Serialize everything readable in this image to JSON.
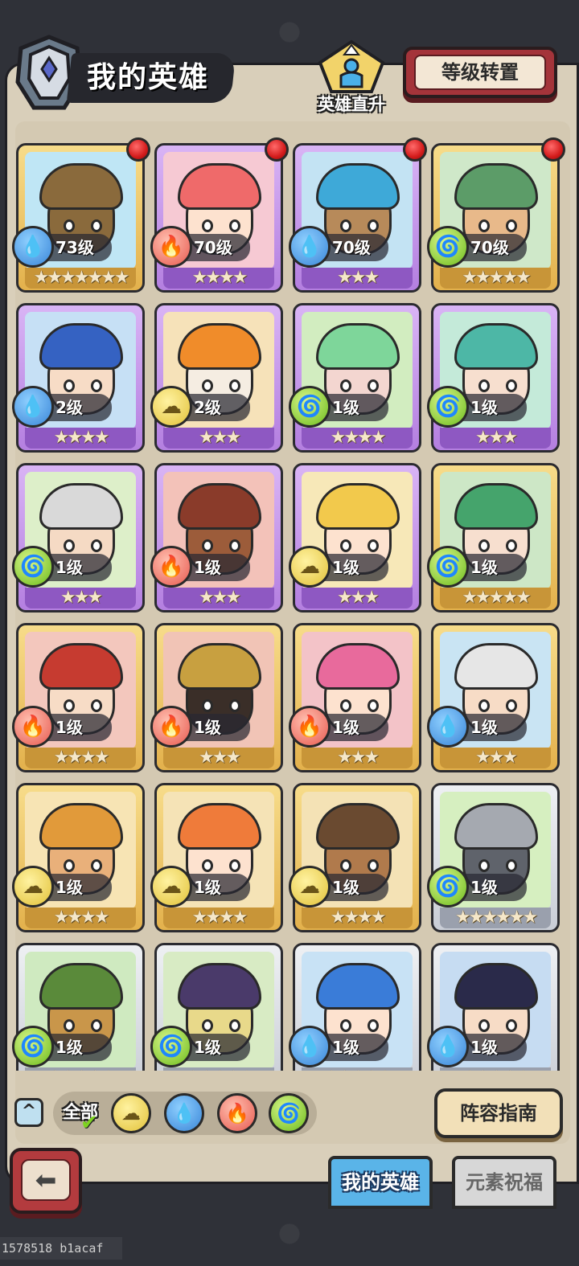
{
  "header": {
    "title": "我的英雄",
    "direct_upgrade_label": "英雄直升",
    "level_transfer_label": "等级转置",
    "emblem_icon": "hero-helmet-icon",
    "direct_upgrade_icon": "hero-arrow-up-icon"
  },
  "heroes": [
    {
      "level": "73级",
      "stars": "★★★★★★★",
      "element": "water",
      "rarity": "gold",
      "red_dot": true,
      "hair": "#8a6a3c",
      "skin": "#8a6a3c",
      "bg": "#bfe6f5"
    },
    {
      "level": "70级",
      "stars": "★★★★",
      "element": "fire",
      "rarity": "purple",
      "red_dot": true,
      "hair": "#ef6a6a",
      "skin": "#fde2cf",
      "bg": "#f6c9d3"
    },
    {
      "level": "70级",
      "stars": "★★★",
      "element": "water",
      "rarity": "purple",
      "red_dot": true,
      "hair": "#3ea9d8",
      "skin": "#b78a5a",
      "bg": "#c3e3f3"
    },
    {
      "level": "70级",
      "stars": "★★★★★",
      "element": "wind",
      "rarity": "gold",
      "red_dot": true,
      "hair": "#5c9c68",
      "skin": "#e8b98a",
      "bg": "#cfe8c9"
    },
    {
      "level": "2级",
      "stars": "★★★★",
      "element": "water",
      "rarity": "purple",
      "red_dot": false,
      "hair": "#3562c2",
      "skin": "#f7dcc6",
      "bg": "#c6e0f5"
    },
    {
      "level": "2级",
      "stars": "★★★",
      "element": "earth",
      "rarity": "purple",
      "red_dot": false,
      "hair": "#f08c2a",
      "skin": "#f5ede2",
      "bg": "#f6e2b9"
    },
    {
      "level": "1级",
      "stars": "★★★★",
      "element": "wind",
      "rarity": "purple",
      "red_dot": false,
      "hair": "#7ed69a",
      "skin": "#f3d6d0",
      "bg": "#d2edc0"
    },
    {
      "level": "1级",
      "stars": "★★★",
      "element": "wind",
      "rarity": "purple",
      "red_dot": false,
      "hair": "#4db7a6",
      "skin": "#f7dfcf",
      "bg": "#c4ead9"
    },
    {
      "level": "1级",
      "stars": "★★★",
      "element": "wind",
      "rarity": "purple",
      "red_dot": false,
      "hair": "#d9d9d9",
      "skin": "#f5dac4",
      "bg": "#ddefc9"
    },
    {
      "level": "1级",
      "stars": "★★★",
      "element": "fire",
      "rarity": "purple",
      "red_dot": false,
      "hair": "#8a3b2a",
      "skin": "#9c5c3a",
      "bg": "#f3c2b9"
    },
    {
      "level": "1级",
      "stars": "★★★",
      "element": "earth",
      "rarity": "purple",
      "red_dot": false,
      "hair": "#f2c94c",
      "skin": "#fde2cf",
      "bg": "#f7e8b8"
    },
    {
      "level": "1级",
      "stars": "★★★★★",
      "element": "wind",
      "rarity": "gold",
      "red_dot": false,
      "hair": "#45a46c",
      "skin": "#f7dfcf",
      "bg": "#cde7c6"
    },
    {
      "level": "1级",
      "stars": "★★★★",
      "element": "fire",
      "rarity": "gold",
      "red_dot": false,
      "hair": "#c63b30",
      "skin": "#f7dcc6",
      "bg": "#f3c7bd"
    },
    {
      "level": "1级",
      "stars": "★★★",
      "element": "fire",
      "rarity": "gold",
      "red_dot": false,
      "hair": "#c8a040",
      "skin": "#3a2e28",
      "bg": "#f1c4b6"
    },
    {
      "level": "1级",
      "stars": "★★★",
      "element": "fire",
      "rarity": "gold",
      "red_dot": false,
      "hair": "#e86a9c",
      "skin": "#fde2cf",
      "bg": "#f3c3c8"
    },
    {
      "level": "1级",
      "stars": "★★★",
      "element": "water",
      "rarity": "gold",
      "red_dot": false,
      "hair": "#e6e6e6",
      "skin": "#f7dcc6",
      "bg": "#c9e4f3"
    },
    {
      "level": "1级",
      "stars": "★★★★",
      "element": "earth",
      "rarity": "gold",
      "red_dot": false,
      "hair": "#e19a3a",
      "skin": "#e9b07a",
      "bg": "#f7e4b4"
    },
    {
      "level": "1级",
      "stars": "★★★★",
      "element": "earth",
      "rarity": "gold",
      "red_dot": false,
      "hair": "#ef7b3a",
      "skin": "#fde2cf",
      "bg": "#f5e3b6"
    },
    {
      "level": "1级",
      "stars": "★★★★",
      "element": "earth",
      "rarity": "gold",
      "red_dot": false,
      "hair": "#6a4a30",
      "skin": "#b07a4c",
      "bg": "#f4e2b5"
    },
    {
      "level": "1级",
      "stars": "★★★★★★",
      "element": "wind",
      "rarity": "silver",
      "red_dot": false,
      "hair": "#a5a9b0",
      "skin": "#5f636b",
      "bg": "#d6efc0"
    },
    {
      "level": "1级",
      "stars": "★★★★★",
      "element": "wind",
      "rarity": "silver",
      "red_dot": false,
      "hair": "#5a8a3a",
      "skin": "#c9964a",
      "bg": "#cfeac0"
    },
    {
      "level": "1级",
      "stars": "★★★★★",
      "element": "wind",
      "rarity": "silver",
      "red_dot": false,
      "hair": "#4a3a6a",
      "skin": "#e8d98a",
      "bg": "#d8ebc4"
    },
    {
      "level": "1级",
      "stars": "★★★★★",
      "element": "water",
      "rarity": "silver",
      "red_dot": false,
      "hair": "#3a7cd8",
      "skin": "#fde2cf",
      "bg": "#c8e2f5"
    },
    {
      "level": "1级",
      "stars": "★★★★★",
      "element": "water",
      "rarity": "silver",
      "red_dot": false,
      "hair": "#2a2a4a",
      "skin": "#f7dcc6",
      "bg": "#c6dcf2"
    }
  ],
  "element_icons": {
    "water": "💧",
    "fire": "🔥",
    "wind": "🌀",
    "earth": "☁"
  },
  "filter_bar": {
    "collapse_icon": "chevron-up-icon",
    "collapse_glyph": "^",
    "all_label": "全部",
    "check_glyph": "✔",
    "elements": [
      "earth",
      "water",
      "fire",
      "wind"
    ]
  },
  "formation_guide_label": "阵容指南",
  "back_glyph": "⬅",
  "tabs": {
    "my_heroes": "我的英雄",
    "element_blessing": "元素祝福"
  },
  "footer_id": "1578518 b1acaf"
}
